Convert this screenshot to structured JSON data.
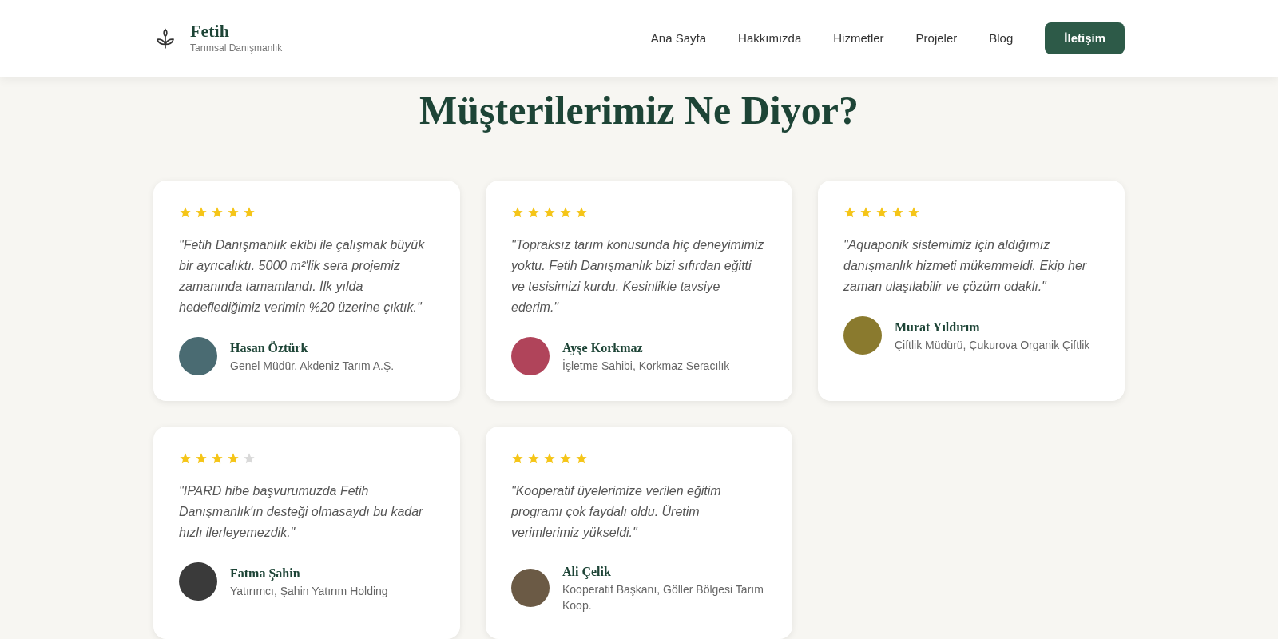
{
  "brand": {
    "name": "Fetih",
    "tagline": "Tarımsal Danışmanlık"
  },
  "nav": {
    "links": [
      "Ana Sayfa",
      "Hakkımızda",
      "Hizmetler",
      "Projeler",
      "Blog"
    ],
    "cta": "İletişim"
  },
  "section": {
    "title": "Müşterilerimiz Ne Diyor?"
  },
  "testimonials": [
    {
      "stars": 5,
      "quote": "\"Fetih Danışmanlık ekibi ile çalışmak büyük bir ayrıcalıktı. 5000 m²'lik sera projemiz zamanında tamamlandı. İlk yılda hedeflediğimiz verimin %20 üzerine çıktık.\"",
      "name": "Hasan Öztürk",
      "role": "Genel Müdür, Akdeniz Tarım A.Ş.",
      "color": "#4a6b72"
    },
    {
      "stars": 5,
      "quote": "\"Topraksız tarım konusunda hiç deneyimimiz yoktu. Fetih Danışmanlık bizi sıfırdan eğitti ve tesisimizi kurdu. Kesinlikle tavsiye ederim.\"",
      "name": "Ayşe Korkmaz",
      "role": "İşletme Sahibi, Korkmaz Seracılık",
      "color": "#b0445a"
    },
    {
      "stars": 5,
      "quote": "\"Aquaponik sistemimiz için aldığımız danışmanlık hizmeti mükemmeldi. Ekip her zaman ulaşılabilir ve çözüm odaklı.\"",
      "name": "Murat Yıldırım",
      "role": "Çiftlik Müdürü, Çukurova Organik Çiftlik",
      "color": "#8a7a2e"
    },
    {
      "stars": 4,
      "quote": "\"IPARD hibe başvurumuzda Fetih Danışmanlık'ın desteği olmasaydı bu kadar hızlı ilerleyemezdik.\"",
      "name": "Fatma Şahin",
      "role": "Yatırımcı, Şahin Yatırım Holding",
      "color": "#3a3a3a"
    },
    {
      "stars": 5,
      "quote": "\"Kooperatif üyelerimize verilen eğitim programı çok faydalı oldu. Üretim verimlerimiz yükseldi.\"",
      "name": "Ali Çelik",
      "role": "Kooperatif Başkanı, Göller Bölgesi Tarım Koop.",
      "color": "#6b5a45"
    }
  ]
}
